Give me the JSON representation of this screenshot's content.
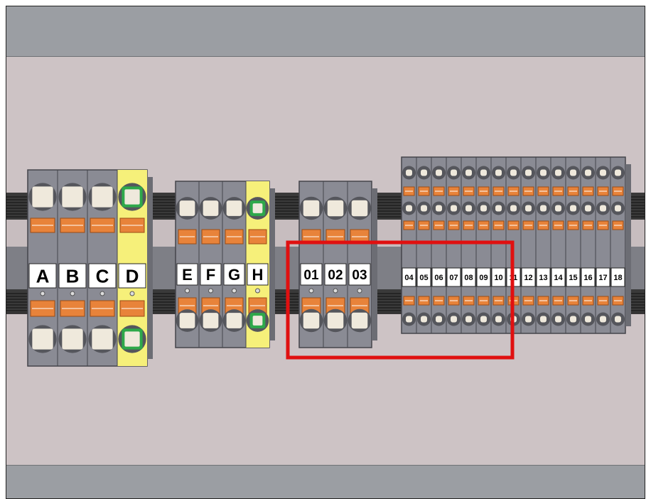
{
  "colors": {
    "background": "#cdc3c5",
    "band": "#9b9ea3",
    "block_gray": "#8a8b94",
    "terminal_face": "#efe9dc",
    "lever_orange": "#e8833a",
    "ground_yellow": "#f6f07a",
    "ground_green": "#2ea84a",
    "highlight_red": "#e01010",
    "rail_black": "#2b2b2b"
  },
  "groups": [
    {
      "id": "group-abcd",
      "labels": [
        "A",
        "B",
        "C",
        "D"
      ],
      "ground_index": 3,
      "style": "large"
    },
    {
      "id": "group-efgh",
      "labels": [
        "E",
        "F",
        "G",
        "H"
      ],
      "ground_index": 3,
      "style": "medium"
    },
    {
      "id": "group-010203",
      "labels": [
        "01",
        "02",
        "03"
      ],
      "ground_index": null,
      "style": "medium"
    },
    {
      "id": "group-04-18",
      "labels": [
        "04",
        "05",
        "06",
        "07",
        "08",
        "09",
        "10",
        "11",
        "12",
        "13",
        "14",
        "15",
        "16",
        "17",
        "18"
      ],
      "ground_index": null,
      "style": "small"
    }
  ],
  "highlight": {
    "description": "highlight-box",
    "target_groups": [
      "group-010203"
    ]
  }
}
